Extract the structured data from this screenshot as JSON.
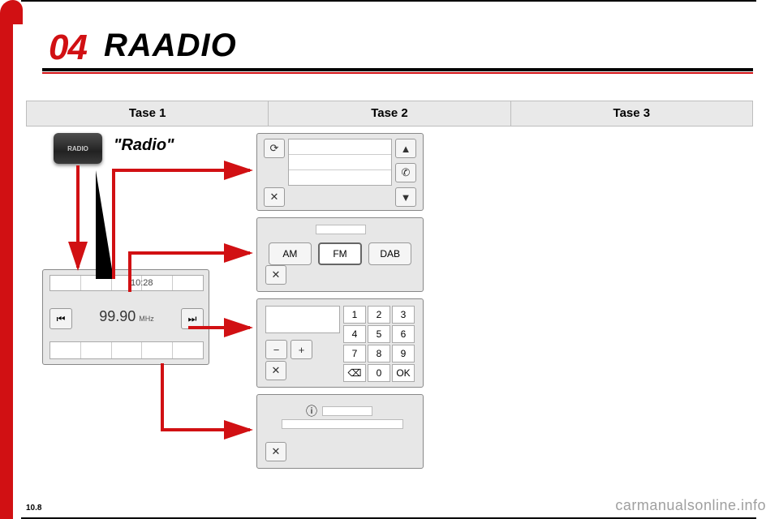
{
  "section": {
    "num": "04",
    "title": "RAADIO"
  },
  "columns": {
    "c1": "Tase 1",
    "c2": "Tase 2",
    "c3": "Tase 3"
  },
  "radio_button_label": "RADIO",
  "radio_quote": "\"Radio\"",
  "device": {
    "clock": "10:28",
    "frequency": "99.90",
    "freq_unit": "MHz",
    "prev_glyph": "⏮",
    "next_glyph": "⏭"
  },
  "list_panel": {
    "refresh_glyph": "⟳",
    "up_glyph": "▲",
    "phone_glyph": "✆",
    "down_glyph": "▼",
    "close_glyph": "✕"
  },
  "band_panel": {
    "am": "AM",
    "fm": "FM",
    "dab": "DAB",
    "close_glyph": "✕"
  },
  "keypad": {
    "minus": "−",
    "plus": "+",
    "k1": "1",
    "k2": "2",
    "k3": "3",
    "k4": "4",
    "k5": "5",
    "k6": "6",
    "k7": "7",
    "k8": "8",
    "k9": "9",
    "bksp": "⌫",
    "k0": "0",
    "ok": "OK",
    "close_glyph": "✕"
  },
  "info_panel": {
    "info_glyph": "ⓘ",
    "close_glyph": "✕"
  },
  "footer": {
    "page": "10.8",
    "watermark": "carmanualsonline.info"
  }
}
